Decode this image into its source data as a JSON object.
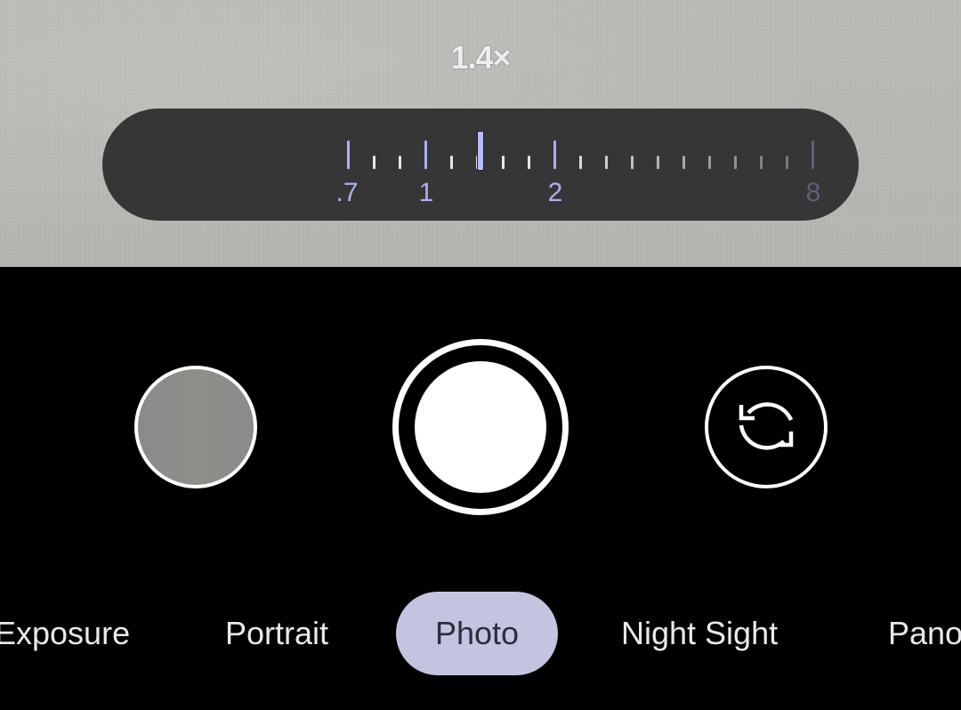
{
  "viewfinder": {
    "zoom_readout": "1.4×"
  },
  "zoom_dial": {
    "current_value": 1.4,
    "min": 0.7,
    "max": 8,
    "labels": [
      ".7",
      "1",
      "2",
      "8"
    ],
    "colors": {
      "accent": "#aab0f2",
      "pill": "#363636",
      "minor_tick": "#e6e6e6"
    }
  },
  "controls": {
    "thumbnail_icon": "last-photo-thumbnail",
    "shutter_icon": "shutter-button",
    "switch_icon": "switch-camera-icon"
  },
  "modes": {
    "items": [
      {
        "label": "Exposure",
        "active": false
      },
      {
        "label": "Portrait",
        "active": false
      },
      {
        "label": "Photo",
        "active": true
      },
      {
        "label": "Night Sight",
        "active": false
      },
      {
        "label": "Pano",
        "active": false
      }
    ],
    "active_color": "#c3c5e0"
  }
}
